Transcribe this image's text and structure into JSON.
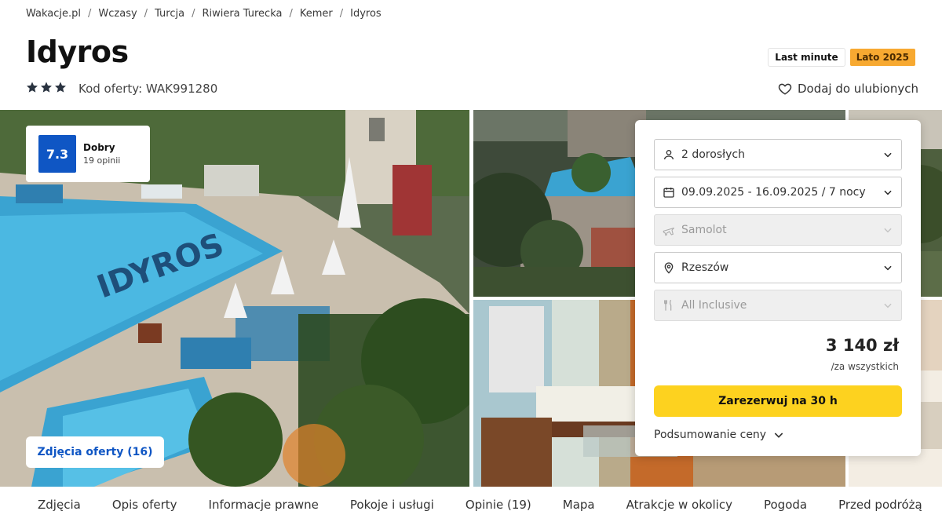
{
  "breadcrumb": [
    "Wakacje.pl",
    "Wczasy",
    "Turcja",
    "Riwiera Turecka",
    "Kemer",
    "Idyros"
  ],
  "hotel": {
    "name": "Idyros",
    "stars": 3,
    "offer_code": "Kod oferty: WAK991280"
  },
  "badges": {
    "last_minute": "Last minute",
    "season": "Lato 2025"
  },
  "favorite_label": "Dodaj do ulubionych",
  "rating": {
    "score": "7.3",
    "label": "Dobry",
    "count": "19 opinii"
  },
  "photos_button": "Zdjęcia oferty (16)",
  "pool_sign": "IDYROS",
  "booking": {
    "guests": "2 dorosłych",
    "dates": "09.09.2025 - 16.09.2025 / 7 nocy",
    "transport": "Samolot",
    "departure": "Rzeszów",
    "board": "All Inclusive",
    "price": "3 140 zł",
    "price_note": "/za wszystkich",
    "reserve_label": "Zarezerwuj na 30 h",
    "summary_label": "Podsumowanie ceny"
  },
  "tabs": [
    "Zdjęcia",
    "Opis oferty",
    "Informacje prawne",
    "Pokoje i usługi",
    "Opinie (19)",
    "Mapa",
    "Atrakcje w okolicy",
    "Pogoda",
    "Przed podróżą"
  ],
  "colors": {
    "accent_blue": "#0f56c4",
    "reserve_yellow": "#fdd21f",
    "season_badge": "#f7a931"
  },
  "icons": {
    "guests": "person-icon",
    "dates": "calendar-icon",
    "transport": "plane-icon",
    "departure": "location-pin-icon",
    "board": "cutlery-icon",
    "favorite": "heart-icon"
  }
}
